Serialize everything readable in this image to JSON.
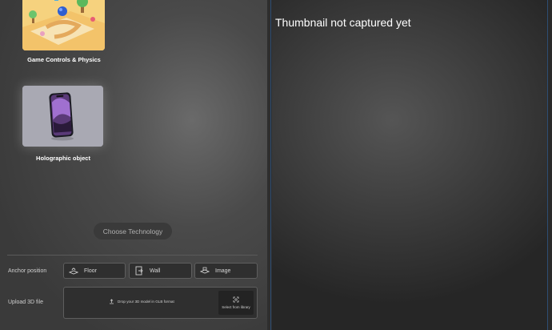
{
  "cards": [
    {
      "label": "Game Controls & Physics",
      "image": "game-scene-thumbnail"
    },
    {
      "label": "Holographic object",
      "image": "phone-3d-thumbnail"
    }
  ],
  "choose_button": {
    "label": "Choose Technology"
  },
  "anchor": {
    "label": "Anchor position",
    "options": [
      {
        "label": "Floor",
        "icon": "floor-icon"
      },
      {
        "label": "Wall",
        "icon": "wall-icon"
      },
      {
        "label": "Image",
        "icon": "image-icon"
      }
    ]
  },
  "upload": {
    "label": "Upload 3D file",
    "drop_text": "Drop your 3D model in GLB format",
    "library_label": "Select from library",
    "upload_icon": "upload-icon",
    "library_icon": "scan-icon"
  },
  "preview": {
    "message": "Thumbnail not captured yet"
  },
  "colors": {
    "panel_bg": "#3a3a3a",
    "preview_bg": "#262626",
    "accent_line": "#2d4d73"
  }
}
